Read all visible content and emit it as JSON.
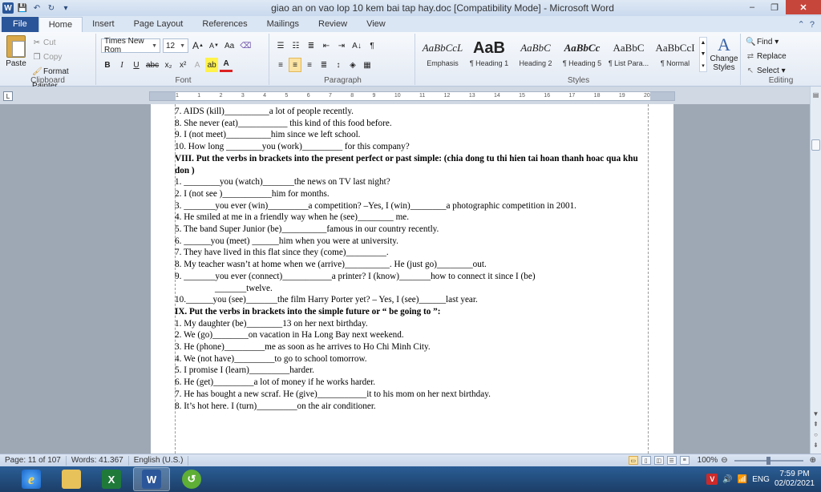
{
  "window": {
    "title": "giao an on vao lop 10 kem bai tap hay.doc [Compatibility Mode] - Microsoft Word",
    "minimize": "–",
    "restore": "❐",
    "close": "✕"
  },
  "tabs": [
    "File",
    "Home",
    "Insert",
    "Page Layout",
    "References",
    "Mailings",
    "Review",
    "View"
  ],
  "tab_right": {
    "minimize_ribbon": "⌃",
    "help": "?"
  },
  "ribbon": {
    "clipboard": {
      "label": "Clipboard",
      "paste": "Paste",
      "cut": "Cut",
      "copy": "Copy",
      "format_painter": "Format Painter"
    },
    "font": {
      "label": "Font",
      "font_name": "Times New Rom",
      "font_size": "12",
      "grow": "A",
      "shrink": "A",
      "change_case": "Aa",
      "bold": "B",
      "italic": "I",
      "underline": "U",
      "strike": "abc",
      "subscript": "x₂",
      "superscript": "x²",
      "highlight": "ab",
      "font_color": "A"
    },
    "paragraph": {
      "label": "Paragraph",
      "sort": "A↓",
      "pilcrow": "¶"
    },
    "styles": {
      "label": "Styles",
      "items": [
        {
          "sample": "AaBbCcL",
          "name": "Emphasis"
        },
        {
          "sample": "AaB",
          "name": "¶ Heading 1"
        },
        {
          "sample": "AaBbC",
          "name": "Heading 2"
        },
        {
          "sample": "AaBbCc",
          "name": "¶ Heading 5"
        },
        {
          "sample": "AaBbC",
          "name": "¶ List Para..."
        },
        {
          "sample": "AaBbCcI",
          "name": "¶ Normal"
        }
      ],
      "change_styles": "Change Styles",
      "change_styles_icon": "A"
    },
    "editing": {
      "label": "Editing",
      "find": "Find",
      "replace": "Replace",
      "select": "Select"
    }
  },
  "ruler": {
    "marks": [
      "1",
      "1",
      "2",
      "3",
      "4",
      "5",
      "6",
      "7",
      "8",
      "9",
      "10",
      "11",
      "12",
      "13",
      "14",
      "15",
      "16",
      "17",
      "18",
      "19",
      "20"
    ]
  },
  "document": {
    "lines": [
      {
        "text": "7. AIDS (kill)__________a lot of people recently.",
        "style": "normal"
      },
      {
        "text": "8. She never (eat)___________ this kind of this food before.",
        "style": "normal"
      },
      {
        "text": "9. I (not meet)__________him since we left school.",
        "style": "normal"
      },
      {
        "text": "10. How long ________you (work)_________ for this company?",
        "style": "normal"
      },
      {
        "text": "VIII. Put the verbs in brackets into the present perfect or past simple: (chia dong tu thi hien tai hoan thanh hoac qua khu don )",
        "style": "head"
      },
      {
        "text": "1. ________you (watch)_______the news on TV last night?",
        "style": "normal"
      },
      {
        "text": "2. I (not see )___________him for months.",
        "style": "normal"
      },
      {
        "text": "3. _______you ever (win)_________a competition? –Yes, I (win)________a photographic competition in 2001.",
        "style": "normal"
      },
      {
        "text": "4. He smiled at me in a friendly way when he (see)________ me.",
        "style": "normal"
      },
      {
        "text": "5. The band Super Junior (be)__________famous in our country recently.",
        "style": "normal"
      },
      {
        "text": "6. ______you (meet) ______him when you were at university.",
        "style": "normal"
      },
      {
        "text": "7. They have lived in this flat since they (come)_________.",
        "style": "normal"
      },
      {
        "text": "8. My teacher wasn’t at home when we (arrive)__________. He (just go)________out.",
        "style": "normal"
      },
      {
        "text": "9. _______you ever (connect)___________a printer? I (know)_______how to connect it since I (be)",
        "style": "normal"
      },
      {
        "text": "_______twelve.",
        "style": "indent"
      },
      {
        "text": "10.______you (see)_______the film Harry Porter yet? – Yes, I (see)______last year.",
        "style": "normal"
      },
      {
        "text": "IX. Put the verbs in brackets into the simple future or “ be going to ”:",
        "style": "head"
      },
      {
        "text": "1. My daughter (be)________13 on her next birthday.",
        "style": "normal"
      },
      {
        "text": "2. We (go)________on vacation in Ha Long Bay next weekend.",
        "style": "normal"
      },
      {
        "text": "3. He (phone)_________me as soon as he arrives to Ho Chi Minh City.",
        "style": "normal"
      },
      {
        "text": "4. We (not have)_________to go to school tomorrow.",
        "style": "normal"
      },
      {
        "text": "5. I promise I (learn)_________harder.",
        "style": "normal"
      },
      {
        "text": "6. He (get)_________a lot of money if he works harder.",
        "style": "normal"
      },
      {
        "text": "7. He has bought a new scraf. He (give)___________it to his mom on her next birthday.",
        "style": "normal"
      },
      {
        "text": "8. It’s hot here. I (turn)_________on the air conditioner.",
        "style": "normal"
      }
    ]
  },
  "status": {
    "page": "Page: 11 of 107",
    "words": "Words: 41.367",
    "language": "English (U.S.)",
    "zoom": "100%"
  },
  "taskbar": {
    "apps": [
      {
        "name": "internet-explorer",
        "glyph": "e"
      },
      {
        "name": "file-explorer",
        "glyph": ""
      },
      {
        "name": "excel",
        "glyph": "X"
      },
      {
        "name": "word",
        "glyph": "W"
      },
      {
        "name": "green-app",
        "glyph": "↺"
      }
    ],
    "tray_v": "V",
    "lang": "ENG",
    "time": "7:59 PM",
    "date": "02/02/2021"
  }
}
